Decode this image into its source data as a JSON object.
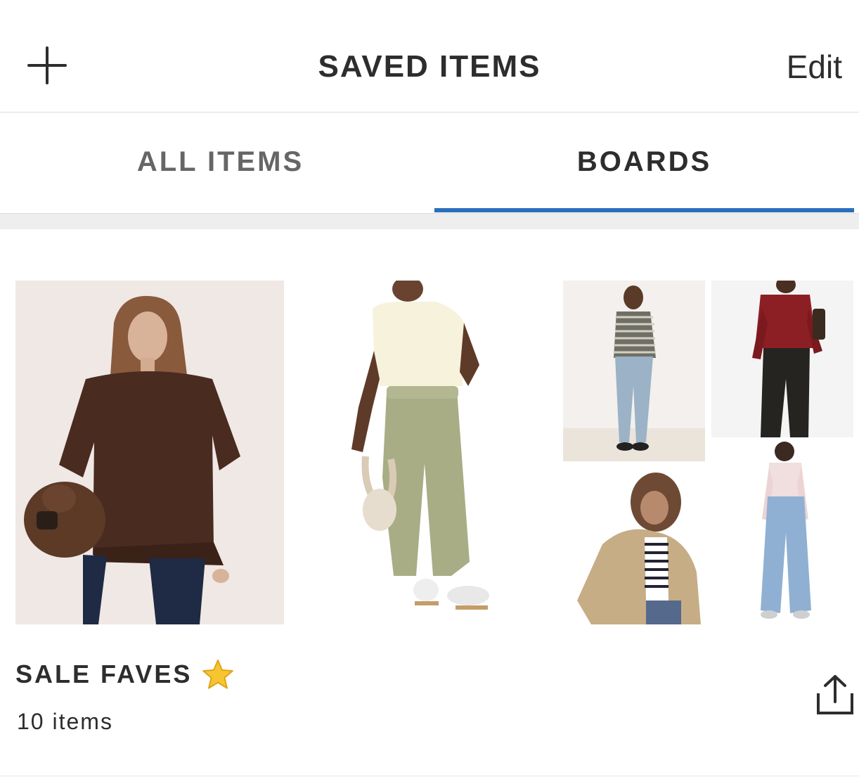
{
  "header": {
    "add_icon": "plus-icon",
    "title": "SAVED ITEMS",
    "edit_label": "Edit"
  },
  "tabs": [
    {
      "label": "ALL ITEMS",
      "active": false
    },
    {
      "label": "BOARDS",
      "active": true
    }
  ],
  "colors": {
    "accent": "#2a6ebc",
    "text": "#2d2d2d",
    "inactive_tab": "#666666",
    "divider": "#dddddd",
    "band": "#eeeeee"
  },
  "boards": [
    {
      "name": "SALE FAVES",
      "emoji_icon": "star-icon",
      "count_label": "10 items",
      "share_icon": "share-icon",
      "thumbnails": [
        "brown-oversized-tee-photo",
        "cream-waistcoat-green-trousers-photo",
        "striped-cardigan-jeans-photo",
        "red-leather-jacket-black-trousers-photo",
        "beige-jacket-striped-top-photo",
        "pink-cardigan-wide-jeans-photo"
      ]
    }
  ]
}
